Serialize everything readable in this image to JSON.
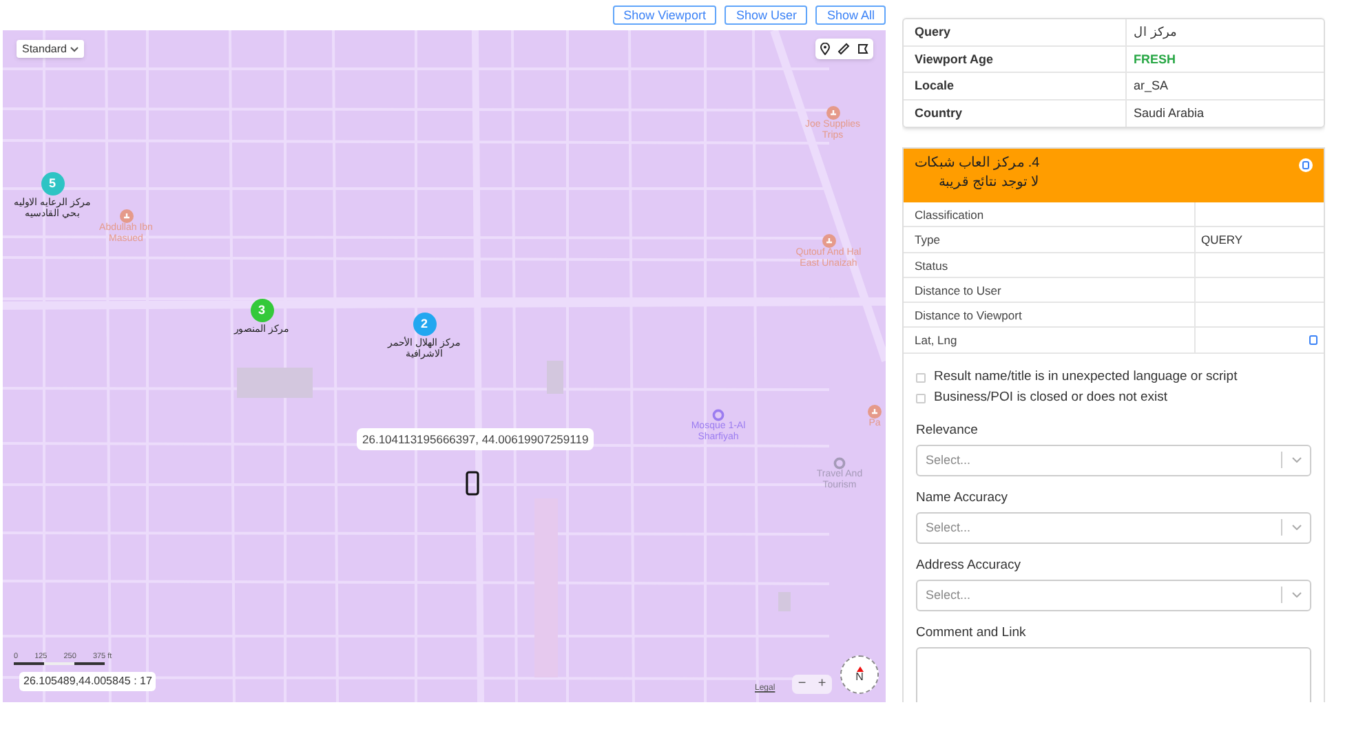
{
  "map_toolbar": {
    "buttons": [
      "Show Viewport",
      "Show User",
      "Show All"
    ]
  },
  "map": {
    "style_select": "Standard",
    "pois": [
      {
        "kind": "landmark",
        "label": "Abdullah Ibn Masued"
      },
      {
        "kind": "shop",
        "label": "Joe Supplies Trips"
      },
      {
        "kind": "shop",
        "label": "Qutouf And Hal East Unaizah"
      },
      {
        "kind": "mosque",
        "label": "Mosque 1-Al Sharfiyah"
      },
      {
        "kind": "place",
        "label": "Travel And Tourism"
      },
      {
        "kind": "shop",
        "label": "Pa"
      }
    ],
    "pins": [
      {
        "number": "5",
        "label": "مركز الرعايه الاوليه بحي القادسيه",
        "color": "#2ec4c4"
      },
      {
        "number": "3",
        "label": "مركز المنصور",
        "color": "#34c93a"
      },
      {
        "number": "2",
        "label": "مركز الهلال الأحمر الاشرافية",
        "color": "#22a7f0"
      }
    ],
    "user_tooltip": "26.104113195666397, 44.00619907259119",
    "scale_ticks": [
      "0",
      "125",
      "250",
      "375 ft"
    ],
    "center_readout": "26.105489,44.005845 : 17",
    "legal_link": "Legal",
    "zoom_out": "−",
    "zoom_in": "+",
    "compass": "N"
  },
  "info_table": [
    {
      "label": "Query",
      "value": "مركز ال"
    },
    {
      "label": "Viewport Age",
      "value": "FRESH",
      "color": "#28a745"
    },
    {
      "label": "Locale",
      "value": "ar_SA"
    },
    {
      "label": "Country",
      "value": "Saudi Arabia"
    }
  ],
  "result": {
    "title": "4. مركز العاب شبكات",
    "subtitle": "لا توجد نتائج قريبة",
    "rows": [
      {
        "label": "Classification"
      },
      {
        "label": "Type",
        "value": "QUERY"
      },
      {
        "label": "Status"
      },
      {
        "label": "Distance to User"
      },
      {
        "label": "Distance to Viewport"
      },
      {
        "label": "Lat, Lng",
        "kind": "copy"
      }
    ],
    "checks": [
      {
        "label": "Result name/title is in unexpected language or script",
        "checked": false
      },
      {
        "label": "Business/POI is closed or does not exist",
        "checked": false
      }
    ],
    "selects": [
      {
        "label": "Relevance",
        "placeholder": "Select..."
      },
      {
        "label": "Name Accuracy",
        "placeholder": "Select..."
      },
      {
        "label": "Address Accuracy",
        "placeholder": "Select..."
      }
    ],
    "comment_label": "Comment and Link"
  }
}
